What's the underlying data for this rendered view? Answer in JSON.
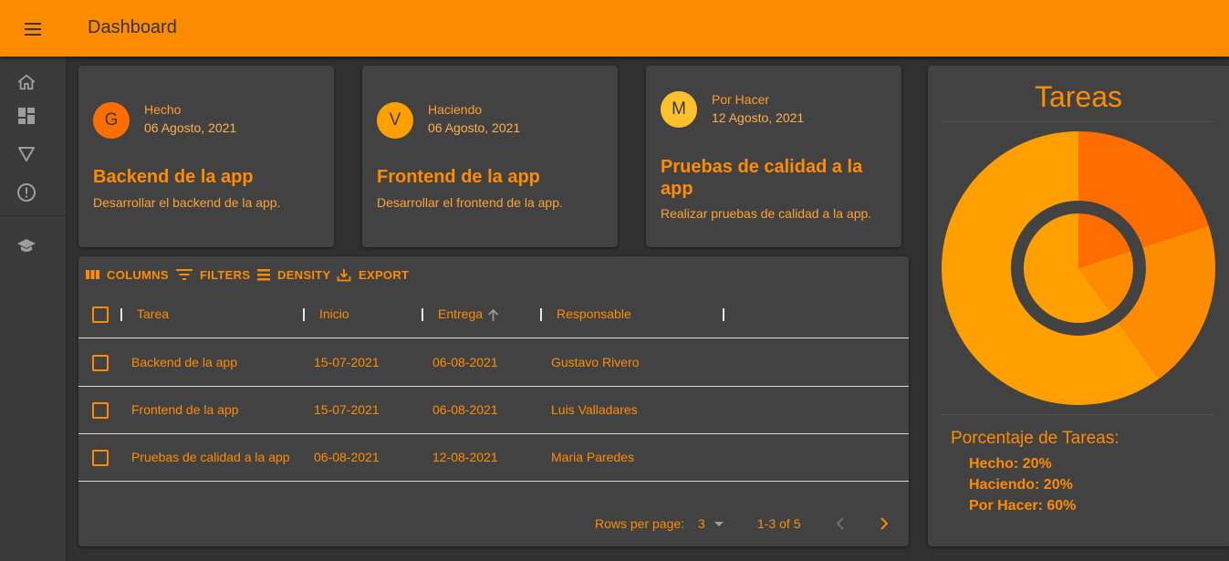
{
  "appbar": {
    "title": "Dashboard",
    "menu_icon": "hamburger-icon"
  },
  "drawer": {
    "items": [
      {
        "icon": "home-icon"
      },
      {
        "icon": "dashboard-icon"
      },
      {
        "icon": "triangle-down-icon"
      },
      {
        "icon": "alert-circle-icon"
      },
      {
        "icon": "school-icon"
      }
    ]
  },
  "cards": [
    {
      "initial": "G",
      "status": "Hecho",
      "date": "06 Agosto, 2021",
      "title": "Backend de la app",
      "description": "Desarrollar el backend de la app.",
      "avatar_color": "#ff6d00"
    },
    {
      "initial": "V",
      "status": "Haciendo",
      "date": "06 Agosto, 2021",
      "title": "Frontend de la app",
      "description": "Desarrollar el frontend de la app.",
      "avatar_color": "#ffa000"
    },
    {
      "initial": "M",
      "status": "Por Hacer",
      "date": "12 Agosto, 2021",
      "title": "Pruebas de calidad a la app",
      "description": "Realizar pruebas de calidad a la app.",
      "avatar_color": "#ffc02e"
    }
  ],
  "grid": {
    "toolbar": {
      "columns": "COLUMNS",
      "filters": "FILTERS",
      "density": "DENSITY",
      "export": "EXPORT"
    },
    "headers": {
      "tarea": "Tarea",
      "inicio": "Inicio",
      "entrega": "Entrega",
      "responsable": "Responsable"
    },
    "rows": [
      {
        "tarea": "Backend de la app",
        "inicio": "15-07-2021",
        "entrega": "06-08-2021",
        "responsable": "Gustavo Rivero"
      },
      {
        "tarea": "Frontend de la app",
        "inicio": "15-07-2021",
        "entrega": "06-08-2021",
        "responsable": "Luis Valladares"
      },
      {
        "tarea": "Pruebas de calidad a la app",
        "inicio": "06-08-2021",
        "entrega": "12-08-2021",
        "responsable": "Maria Paredes"
      }
    ],
    "footer": {
      "rows_per_page_label": "Rows per page:",
      "rows_per_page_value": "3",
      "range": "1-3 of 5"
    }
  },
  "chart_panel": {
    "title": "Tareas",
    "percent_title": "Porcentaje de Tareas:",
    "items": [
      "Hecho: 20%",
      "Haciendo: 20%",
      "Por Hacer: 60%"
    ]
  },
  "chart_data": {
    "type": "pie",
    "categories": [
      "Hecho",
      "Haciendo",
      "Por Hacer"
    ],
    "values": [
      20,
      20,
      60
    ],
    "colors": [
      "#ff6d00",
      "#ff8c00",
      "#ffa000"
    ]
  }
}
